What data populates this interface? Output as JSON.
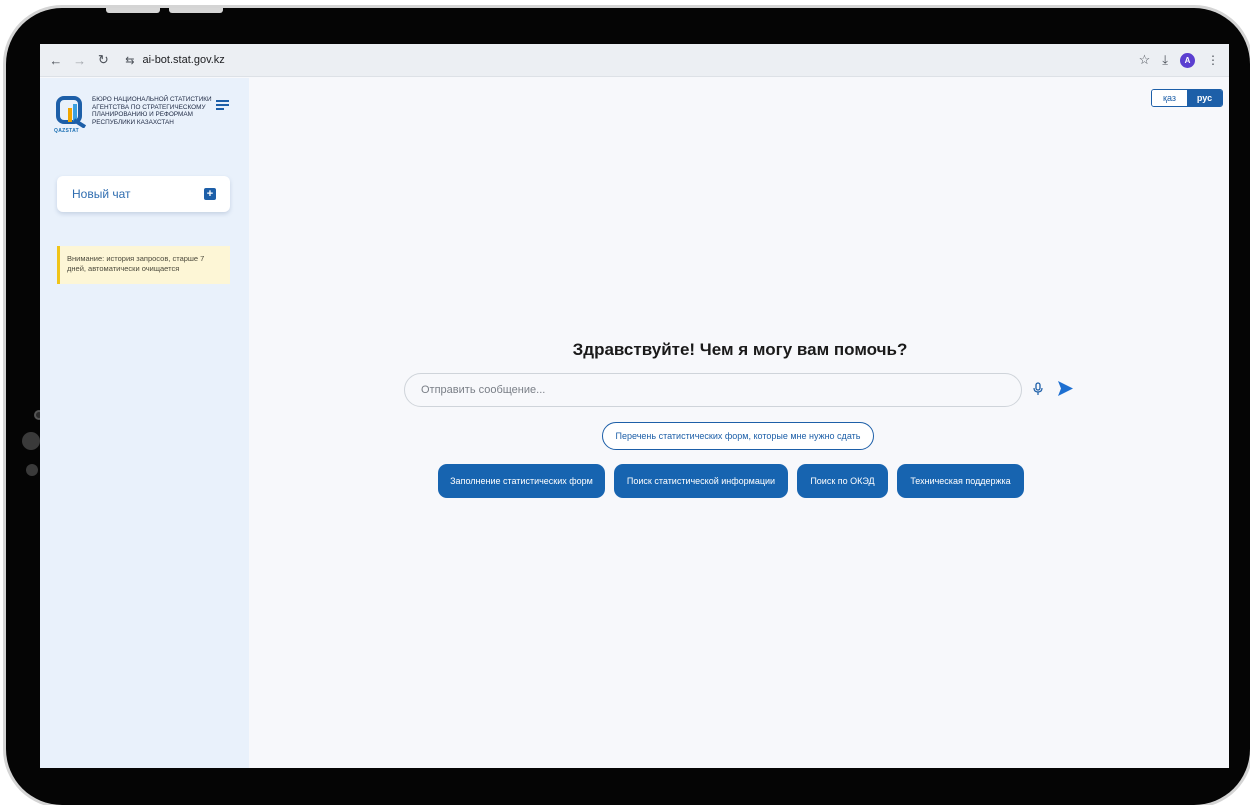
{
  "browser": {
    "url": "ai-bot.stat.gov.kz",
    "profile_initial": "A"
  },
  "sidebar": {
    "logo_brand": "QAZSTAT",
    "logo_text": "БЮРО НАЦИОНАЛЬНОЙ СТАТИСТИКИ АГЕНТСТВА ПО СТРАТЕГИЧЕСКОМУ ПЛАНИРОВАНИЮ И РЕФОРМАМ РЕСПУБЛИКИ КАЗАХСТАН",
    "new_chat_label": "Новый чат",
    "warning": "Внимание: история запросов, старше 7 дней, автоматически очищается"
  },
  "language": {
    "options": [
      "қаз",
      "рус"
    ],
    "selected": "рус"
  },
  "main": {
    "greeting": "Здравствуйте! Чем я могу вам помочь?",
    "input_placeholder": "Отправить сообщение...",
    "suggestion": "Перечень статистических форм, которые мне нужно сдать",
    "chips": [
      "Заполнение статистических форм",
      "Поиск статистической информации",
      "Поиск по ОКЭД",
      "Техническая поддержка"
    ]
  },
  "colors": {
    "accent": "#1764b0",
    "sidebar_bg": "#e9f1fb",
    "warning_bg": "#fdf6d6",
    "warning_border": "#f0c419"
  },
  "icons": [
    "back-icon",
    "forward-icon",
    "reload-icon",
    "site-settings-icon",
    "star-icon",
    "download-icon",
    "kebab-menu-icon",
    "hamburger-menu-icon",
    "plus-icon",
    "microphone-icon",
    "send-icon"
  ]
}
